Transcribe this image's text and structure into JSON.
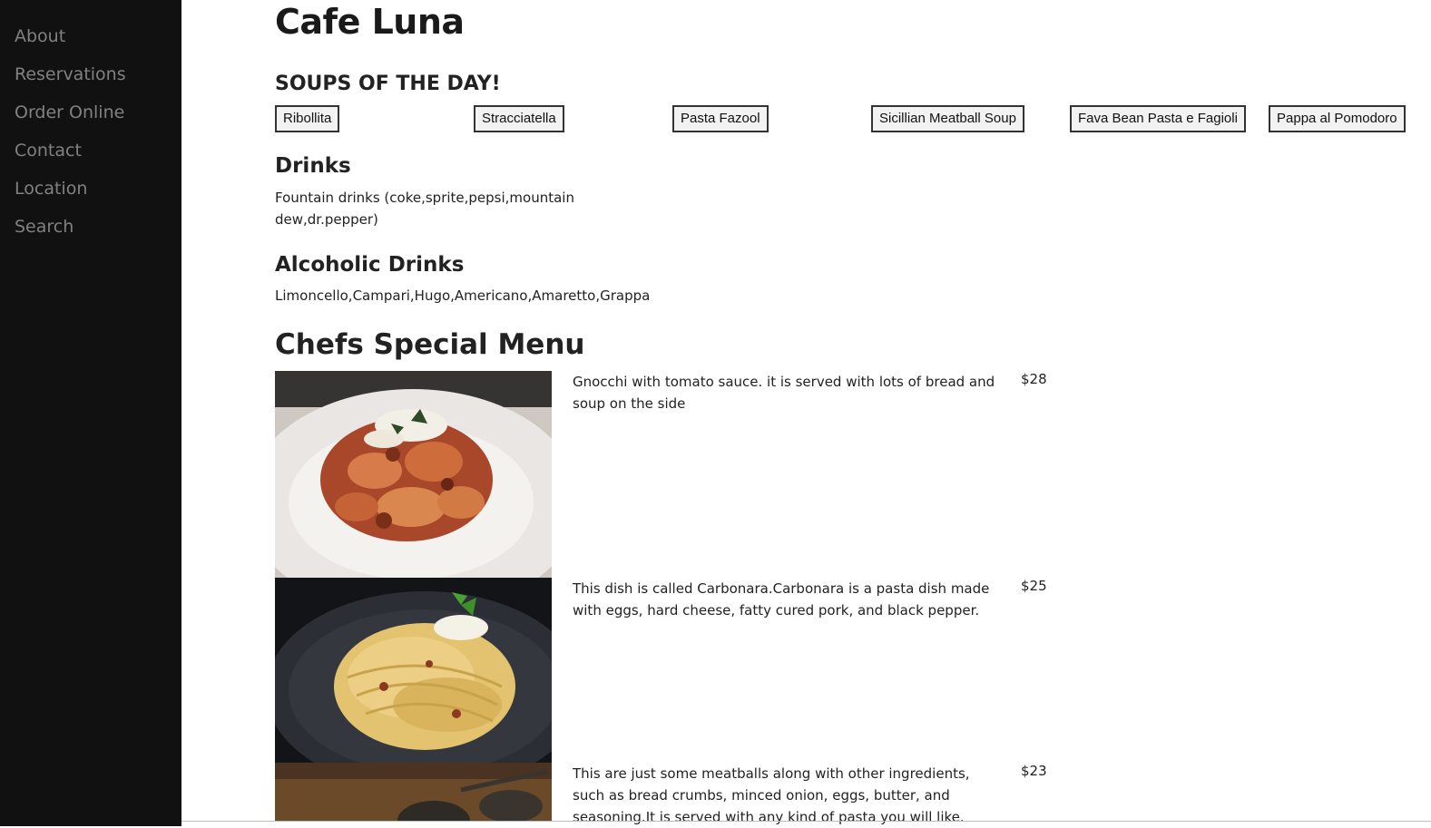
{
  "sidebar": {
    "items": [
      {
        "label": "About"
      },
      {
        "label": "Reservations"
      },
      {
        "label": "Order Online"
      },
      {
        "label": "Contact"
      },
      {
        "label": "Location"
      },
      {
        "label": "Search"
      }
    ]
  },
  "site": {
    "title": "Cafe Luna"
  },
  "soups": {
    "heading": "SOUPS OF THE DAY!",
    "items": [
      {
        "label": "Ribollita"
      },
      {
        "label": "Stracciatella"
      },
      {
        "label": "Pasta Fazool"
      },
      {
        "label": "Sicillian Meatball Soup"
      },
      {
        "label": "Fava Bean Pasta e Fagioli"
      },
      {
        "label": "Pappa al Pomodoro"
      }
    ]
  },
  "drinks": {
    "heading": "Drinks",
    "text": "Fountain drinks (coke,sprite,pepsi,mountain dew,dr.pepper)"
  },
  "alcoholic": {
    "heading": "Alcoholic Drinks",
    "text": "Limoncello,Campari,Hugo,Americano,Amaretto,Grappa"
  },
  "chefs": {
    "heading": "Chefs Special Menu",
    "dishes": [
      {
        "image": "gnocchi-bolognese-photo",
        "description": "Gnocchi with tomato sauce. it is served with lots of bread and soup on the side",
        "price": "$28"
      },
      {
        "image": "carbonara-spaghetti-photo",
        "description": "This dish is called Carbonara.Carbonara is a pasta dish made with eggs, hard cheese, fatty cured pork, and black pepper.",
        "price": "$25"
      },
      {
        "image": "meatballs-photo",
        "description": "This are just some meatballs along with other ingredients, such as bread crumbs, minced onion, eggs, butter, and seasoning.It is served with any kind of pasta you will like.",
        "price": "$23"
      }
    ]
  },
  "colors": {
    "sidebar_bg": "#111111",
    "sidebar_link": "#818181",
    "page_bg": "#ffffff",
    "text": "#222222"
  }
}
